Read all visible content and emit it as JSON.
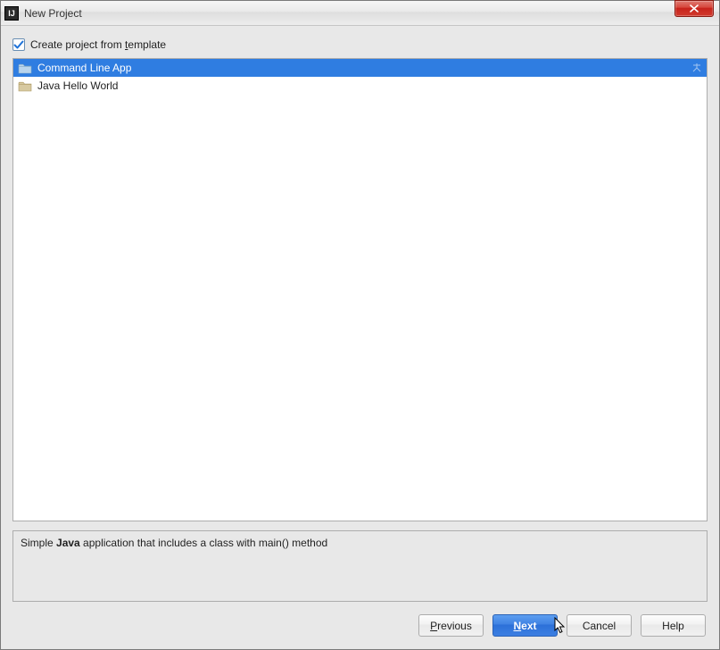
{
  "window": {
    "title": "New Project"
  },
  "checkbox": {
    "label_prefix": "Create project from ",
    "label_underlined": "t",
    "label_suffix": "emplate",
    "checked": true
  },
  "templates": [
    {
      "label": "Command Line App",
      "selected": true
    },
    {
      "label": "Java Hello World",
      "selected": false
    }
  ],
  "description": {
    "prefix": "Simple ",
    "bold": "Java",
    "suffix": " application that includes a class with main() method"
  },
  "buttons": {
    "previous": {
      "underlined": "P",
      "rest": "revious"
    },
    "next": {
      "underlined": "N",
      "rest": "ext"
    },
    "cancel": "Cancel",
    "help": "Help"
  }
}
